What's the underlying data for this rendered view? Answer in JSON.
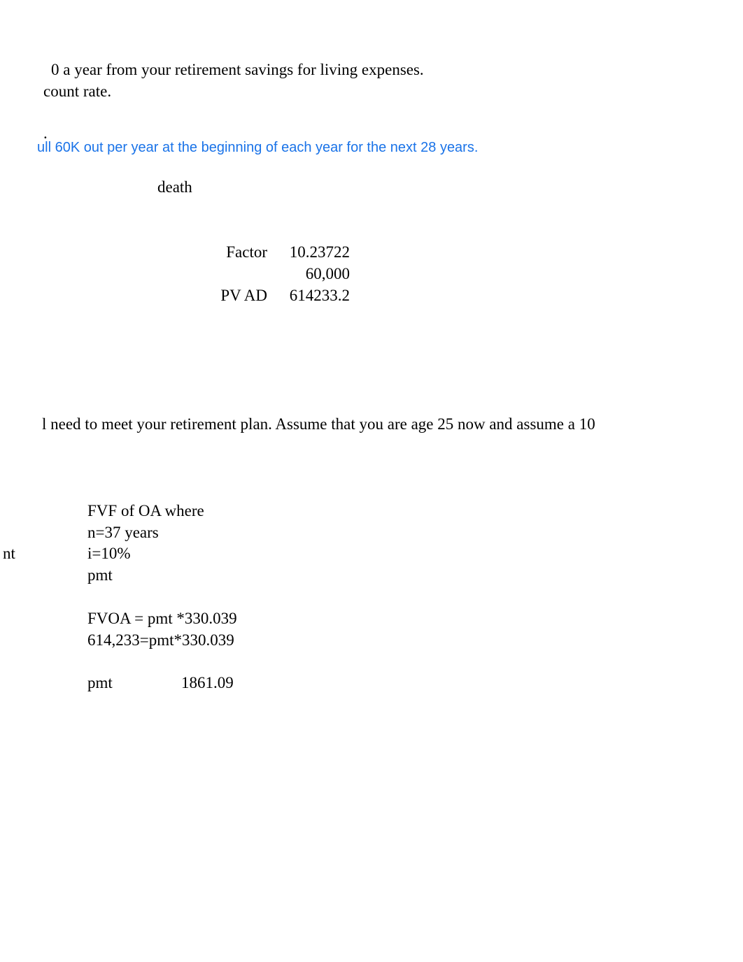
{
  "header": {
    "line1": "0 a year from your retirement savings for living expenses.",
    "line2": " count rate."
  },
  "dot": ".",
  "blue_note": "ull 60K out per year at the beginning of each year for the next 28 years.",
  "death_label": "death",
  "table1": {
    "row1_label": "Factor",
    "row1_value": "10.23722",
    "row2_value": "60,000",
    "row3_label": "PV AD",
    "row3_value": "614233.2"
  },
  "mid_text": "l need to meet your retirement plan.  Assume that you are age 25 now and assume a 10",
  "nt_label": "nt",
  "calc": {
    "line1": "FVF of OA where",
    "line2": "n=37 years",
    "line3": "i=10%",
    "line4": "pmt",
    "line5": "FVOA = pmt *330.039",
    "line6": "614,233=pmt*330.039",
    "line7_label": "pmt",
    "line7_value": "1861.09"
  }
}
